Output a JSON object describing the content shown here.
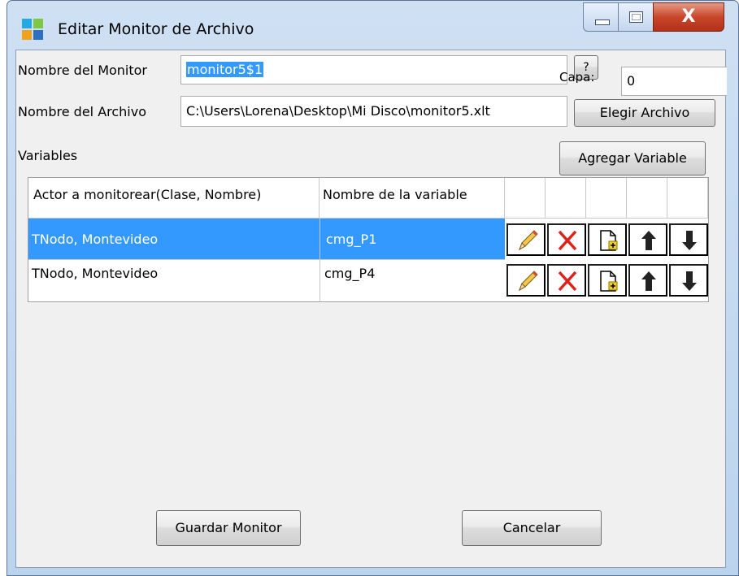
{
  "window": {
    "title": "Editar Monitor de Archivo",
    "close_glyph": "X"
  },
  "form": {
    "monitor_name_label": "Nombre del Monitor",
    "monitor_name_value": "monitor5$1",
    "help_button": "?",
    "layer_label": "Capa:",
    "layer_value": "0",
    "file_name_label": "Nombre del Archivo",
    "file_name_value": "C:\\Users\\Lorena\\Desktop\\Mi Disco\\monitor5.xlt",
    "choose_file_button": "Elegir Archivo",
    "variables_label": "Variables",
    "add_variable_button": "Agregar Variable"
  },
  "table": {
    "headers": [
      "Actor a monitorear(Clase, Nombre)",
      "Nombre de la variable"
    ],
    "rows": [
      {
        "actor": "TNodo, Montevideo",
        "variable": "cmg_P1",
        "selected": true
      },
      {
        "actor": "TNodo, Montevideo",
        "variable": "cmg_P4",
        "selected": false
      }
    ],
    "row_actions": [
      "edit-icon",
      "delete-icon",
      "new-document-icon",
      "move-up-icon",
      "move-down-icon"
    ]
  },
  "footer": {
    "save_button": "Guardar Monitor",
    "cancel_button": "Cancelar"
  },
  "colors": {
    "selection": "#3399ff",
    "delete_red": "#e0201a"
  }
}
